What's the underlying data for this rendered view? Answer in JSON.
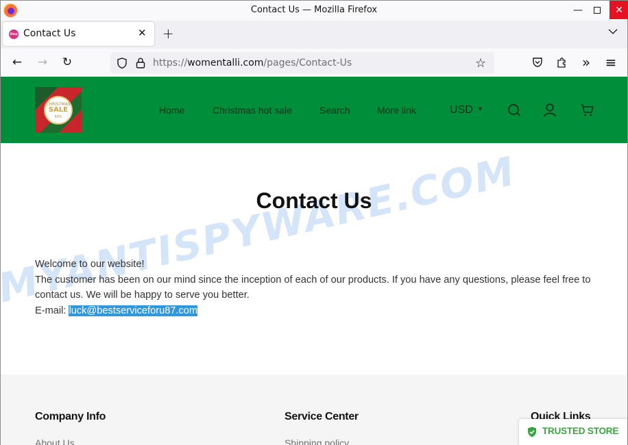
{
  "window": {
    "title": "Contact Us — Mozilla Firefox",
    "minimize": "—",
    "maximize": "",
    "close": "✕"
  },
  "tabs": [
    {
      "title": "Contact Us",
      "favicon_text": "Shop",
      "active": true
    }
  ],
  "tabbar": {
    "close_tab": "✕",
    "new_tab": "+",
    "list_tabs": "⌵"
  },
  "navbar": {
    "back": "←",
    "forward": "→",
    "reload": "↻",
    "url_prefix": "https://",
    "url_domain": "womentalli.com",
    "url_path": "/pages/Contact-Us",
    "bookmark": "☆",
    "overflow": "»",
    "menu": "≡"
  },
  "site": {
    "header_color": "#008e3b",
    "logo": {
      "line1": "CHRISTMAS",
      "line2": "SALE",
      "line3": "50%"
    },
    "menu": [
      "Home",
      "Christmas hot sale",
      "Search",
      "More link"
    ],
    "currency": "USD"
  },
  "main": {
    "title": "Contact Us",
    "welcome": "Welcome to our website!",
    "paragraph": "The customer has been on our mind since the inception of each of our products. If you have any questions, please feel free to contact us. We will be happy to serve you better.",
    "email_label": "E-mail: ",
    "email": "luck@bestserviceforu87.com",
    "watermark": "MYANTISPYWARE.COM"
  },
  "footer": {
    "columns": [
      {
        "heading": "Company Info",
        "first_link": "About Us"
      },
      {
        "heading": "Service Center",
        "first_link": "Shipping policy"
      },
      {
        "heading": "Quick Links",
        "first_link": ""
      }
    ],
    "trusted_badge": "TRUSTED STORE",
    "trusted_color": "#3aa444"
  }
}
